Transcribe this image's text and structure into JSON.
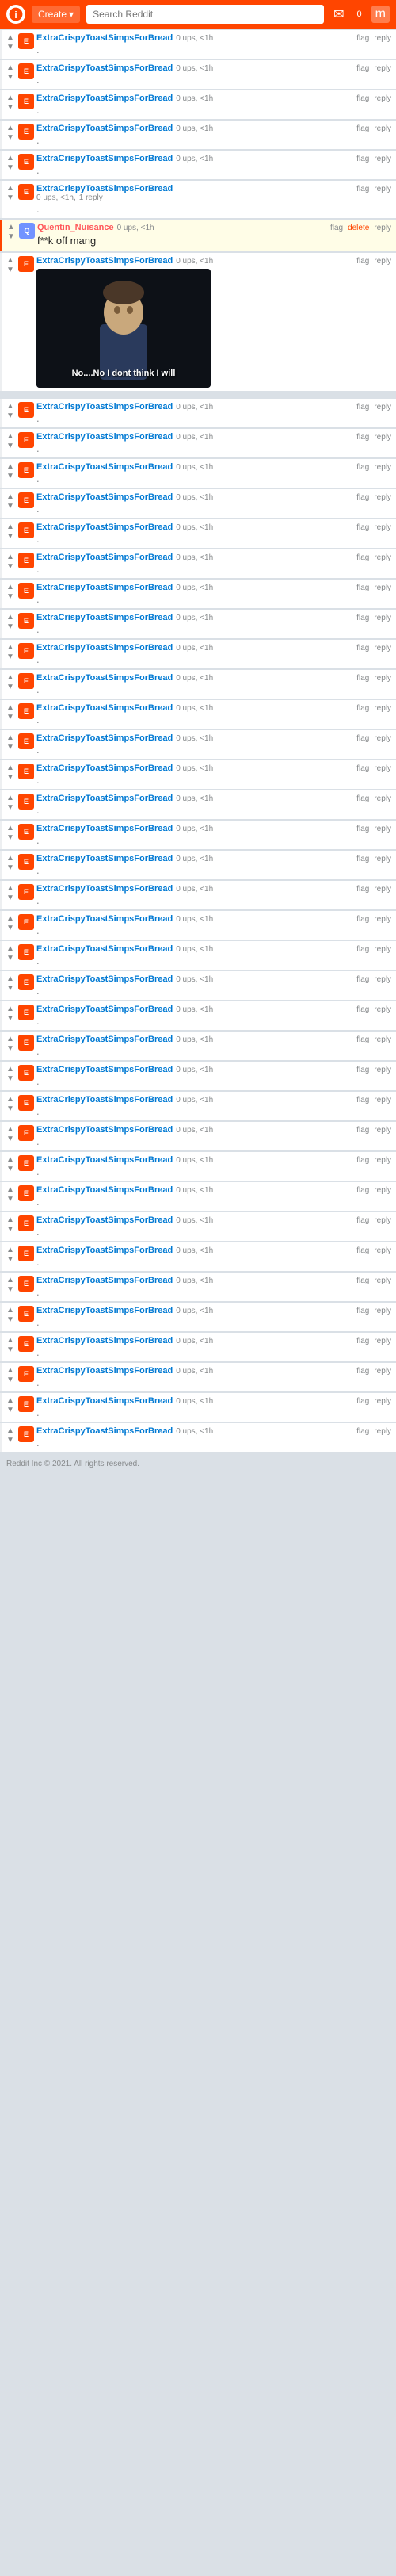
{
  "header": {
    "create_label": "Create",
    "search_placeholder": "Search Reddit",
    "mail_label": "0",
    "profile_label": "m"
  },
  "comments": [
    {
      "id": 1,
      "username": "ExtraCrispyToastSimpsForBread",
      "ups": "0 ups",
      "time": "<1h",
      "text": ".",
      "has_image": false
    },
    {
      "id": 2,
      "username": "ExtraCrispyToastSimpsForBread",
      "ups": "0 ups",
      "time": "<1h",
      "text": ".",
      "has_image": false
    },
    {
      "id": 3,
      "username": "ExtraCrispyToastSimpsForBread",
      "ups": "0 ups",
      "time": "<1h",
      "text": ".",
      "has_image": false
    },
    {
      "id": 4,
      "username": "ExtraCrispyToastSimpsForBread",
      "ups": "0 ups",
      "time": "<1h",
      "text": ".",
      "has_image": false
    },
    {
      "id": 5,
      "username": "ExtraCrispyToastSimpsForBread",
      "ups": "0 ups",
      "time": "<1h",
      "text": ".",
      "has_image": false
    },
    {
      "id": 6,
      "username": "ExtraCrispyToastSimpsForBread",
      "ups": "0 ups",
      "time": "<1h",
      "reply_count": "1 reply",
      "text": ".",
      "has_image": false
    },
    {
      "id": 7,
      "username": "Quentin_Nuisance",
      "ups": "0 ups",
      "time": "<1h",
      "text": "f**k off mang",
      "has_image": false,
      "special": true
    },
    {
      "id": 8,
      "username": "ExtraCrispyToastSimpsForBread",
      "ups": "0 ups",
      "time": "<1h",
      "text": "",
      "has_image": true
    }
  ],
  "regular_comments": [
    {
      "id": 9
    },
    {
      "id": 10
    },
    {
      "id": 11
    },
    {
      "id": 12
    },
    {
      "id": 13
    },
    {
      "id": 14
    },
    {
      "id": 15
    },
    {
      "id": 16
    },
    {
      "id": 17
    },
    {
      "id": 18
    },
    {
      "id": 19
    },
    {
      "id": 20
    },
    {
      "id": 21
    },
    {
      "id": 22
    },
    {
      "id": 23
    },
    {
      "id": 24
    },
    {
      "id": 25
    },
    {
      "id": 26
    },
    {
      "id": 27
    },
    {
      "id": 28
    },
    {
      "id": 29
    },
    {
      "id": 30
    },
    {
      "id": 31
    },
    {
      "id": 32
    },
    {
      "id": 33
    },
    {
      "id": 34
    },
    {
      "id": 35
    }
  ],
  "labels": {
    "flag": "flag",
    "reply": "reply",
    "delete": "delete",
    "ups_text": "0 ups",
    "time_text": "<1h",
    "username": "ExtraCrispyToastSimpsForBread",
    "dot": ".",
    "meme_caption": "No....No I dont think I will"
  },
  "colors": {
    "upvote": "#ff4500",
    "downvote": "#7193ff",
    "neutral": "#878a8c",
    "link": "#0079d3",
    "special": "#ff585b"
  }
}
